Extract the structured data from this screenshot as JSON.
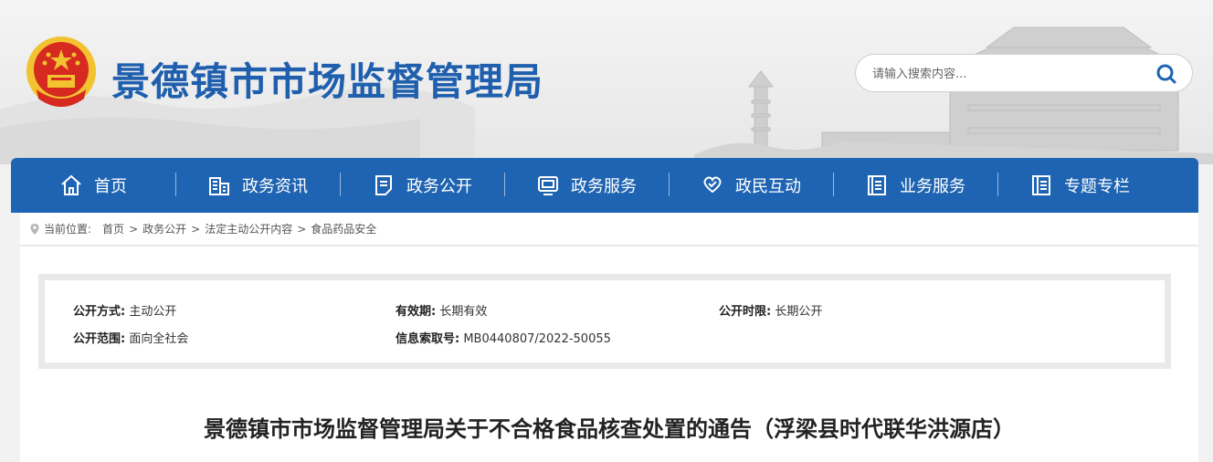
{
  "site": {
    "title": "景德镇市市场监督管理局",
    "search_placeholder": "请输入搜索内容..."
  },
  "nav": [
    {
      "label": "首页",
      "icon": "home-icon"
    },
    {
      "label": "政务资讯",
      "icon": "building-icon"
    },
    {
      "label": "政务公开",
      "icon": "document-icon"
    },
    {
      "label": "政务服务",
      "icon": "service-window-icon"
    },
    {
      "label": "政民互动",
      "icon": "heart-chat-icon"
    },
    {
      "label": "业务服务",
      "icon": "list-icon"
    },
    {
      "label": "专题专栏",
      "icon": "book-icon"
    }
  ],
  "breadcrumb": {
    "prefix": "当前位置:",
    "items": [
      "首页",
      "政务公开",
      "法定主动公开内容",
      "食品药品安全"
    ],
    "separator": ">"
  },
  "meta": {
    "method_label": "公开方式:",
    "method_value": "主动公开",
    "validity_label": "有效期:",
    "validity_value": "长期有效",
    "period_label": "公开时限:",
    "period_value": "长期公开",
    "scope_label": "公开范围:",
    "scope_value": "面向全社会",
    "index_label": "信息索取号:",
    "index_value": "MB0440807/2022-50055"
  },
  "article": {
    "title": "景德镇市市场监督管理局关于不合格食品核查处置的通告（浮梁县时代联华洪源店）"
  },
  "colors": {
    "brand_blue": "#1f64b2",
    "title_blue": "#1f5fae",
    "emblem_red": "#d62a20",
    "emblem_gold": "#f2c230"
  }
}
